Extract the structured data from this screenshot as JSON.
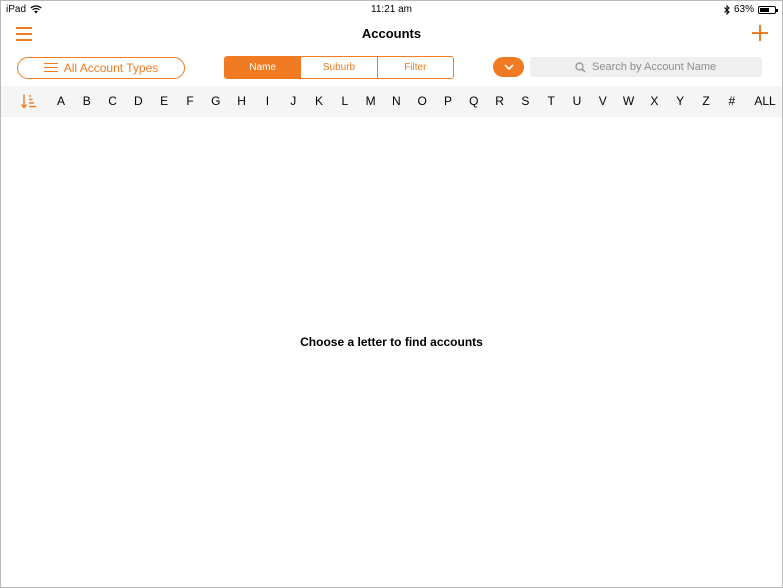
{
  "status": {
    "device": "iPad",
    "time": "11:21 am",
    "battery": "63%",
    "battery_level": 0.63
  },
  "nav": {
    "title": "Accounts"
  },
  "toolbar": {
    "account_types_label": "All Account Types",
    "segments": [
      {
        "label": "Name",
        "active": true
      },
      {
        "label": "Suburb",
        "active": false
      },
      {
        "label": "Filter",
        "active": false
      }
    ],
    "search_placeholder": "Search by Account Name"
  },
  "alphabet": [
    "A",
    "B",
    "C",
    "D",
    "E",
    "F",
    "G",
    "H",
    "I",
    "J",
    "K",
    "L",
    "M",
    "N",
    "O",
    "P",
    "Q",
    "R",
    "S",
    "T",
    "U",
    "V",
    "W",
    "X",
    "Y",
    "Z",
    "#",
    "ALL"
  ],
  "empty_message": "Choose a letter to find accounts",
  "colors": {
    "accent": "#f07b22",
    "alpha_bar_bg": "#f5f5f5",
    "search_bg": "#efefef"
  }
}
